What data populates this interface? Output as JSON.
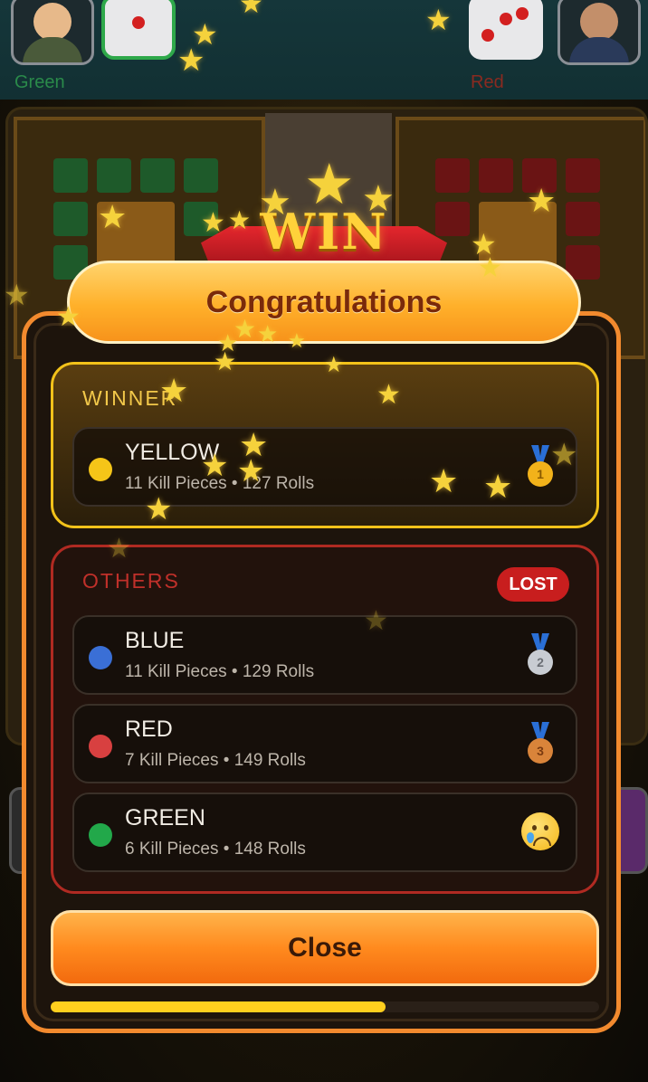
{
  "players_top": {
    "left_name": "Green",
    "right_name": "Red",
    "left_dice_value": 1,
    "right_dice_value": 3
  },
  "banner": {
    "text": "WIN"
  },
  "modal": {
    "title": "Congratulations",
    "winner_label": "WINNER",
    "others_label": "OTHERS",
    "lost_badge": "LOST",
    "winner": {
      "name": "YELLOW",
      "stats": "11 Kill Pieces • 127 Rolls",
      "color": "#f5c518",
      "medal": "gold-medal-1"
    },
    "others": [
      {
        "name": "BLUE",
        "stats": "11 Kill Pieces • 129 Rolls",
        "color": "#3a6fd6",
        "medal": "silver-medal-2"
      },
      {
        "name": "RED",
        "stats": "7 Kill Pieces • 149 Rolls",
        "color": "#d84040",
        "medal": "bronze-medal-3"
      },
      {
        "name": "GREEN",
        "stats": "6 Kill Pieces • 148 Rolls",
        "color": "#22a84a",
        "medal": "crying-face"
      }
    ],
    "close_label": "Close",
    "progress": 0.61
  },
  "colors": {
    "accent_orange": "#f28a2e",
    "winner_gold": "#f2c21a",
    "others_red": "#b02a22",
    "label_winner": "#f2c84a",
    "label_others": "#c0302a"
  }
}
